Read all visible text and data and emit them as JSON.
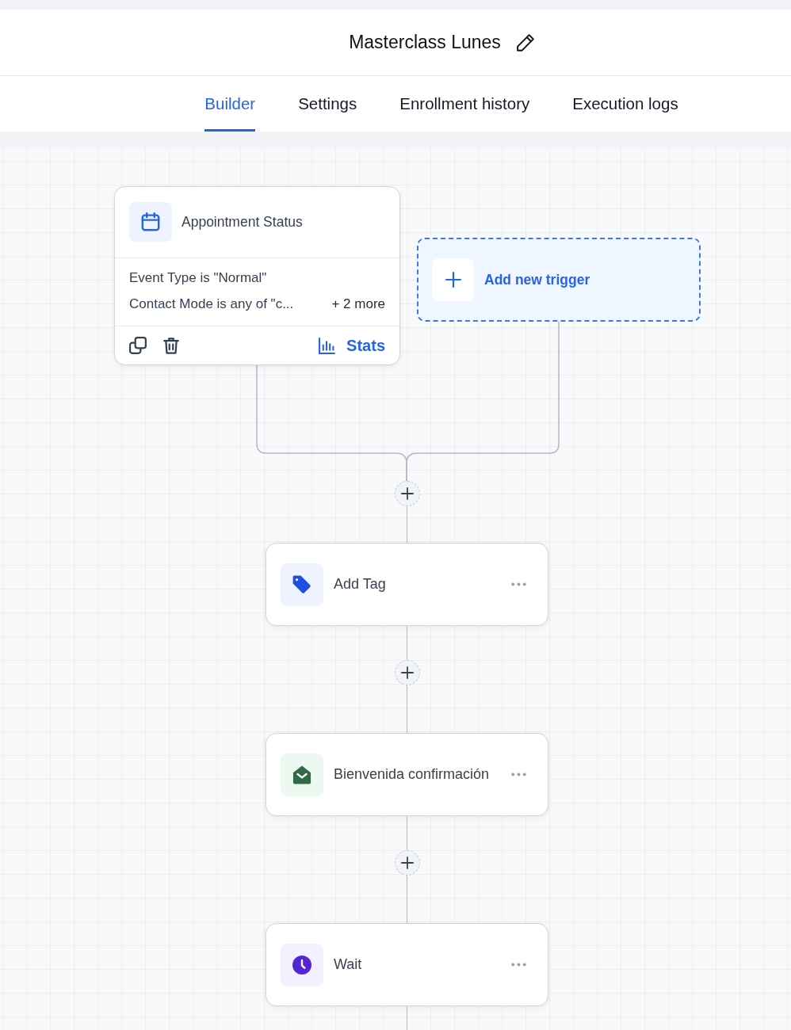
{
  "header": {
    "title": "Masterclass Lunes"
  },
  "tabs": [
    {
      "label": "Builder",
      "selected": true
    },
    {
      "label": "Settings",
      "selected": false
    },
    {
      "label": "Enrollment history",
      "selected": false
    },
    {
      "label": "Execution logs",
      "selected": false
    }
  ],
  "triggers": [
    {
      "kind": "appointment",
      "title": "Appointment Status",
      "conditions": [
        "Event Type is \"Normal\"",
        "Contact Mode is any of \"c..."
      ],
      "more": "+ 2 more",
      "stats": "Stats"
    }
  ],
  "add_trigger": {
    "label": "Add new trigger"
  },
  "actions": [
    {
      "kind": "tag",
      "title": "Add Tag"
    },
    {
      "kind": "email",
      "title": "Bienvenida confirmación"
    },
    {
      "kind": "wait",
      "title": "Wait"
    }
  ]
}
